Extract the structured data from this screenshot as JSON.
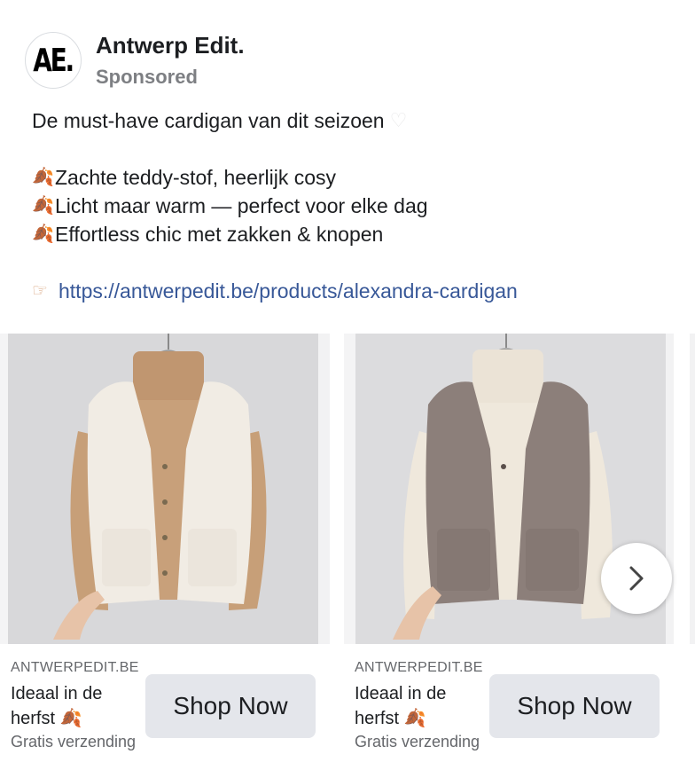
{
  "post": {
    "page_name": "Antwerp Edit.",
    "avatar_text": "AE.",
    "sponsored_label": "Sponsored",
    "headline": "De must-have cardigan van dit seizoen",
    "bullets": [
      "Zachte teddy-stof, heerlijk cosy",
      "Licht maar warm — perfect voor elke dag",
      "Effortless chic met zakken & knopen"
    ],
    "link": "https://antwerpedit.be/products/alexandra-cardigan"
  },
  "icons": {
    "heart": "white-heart-emoji",
    "leaf": "fallen-leaf-emoji",
    "pointing": "pointing-right-emoji"
  },
  "carousel": {
    "cards": [
      {
        "domain": "ANTWERPEDIT.BE",
        "title": "Ideaal in de herfst",
        "subtitle": "Gratis verzending",
        "button_label": "Shop Now"
      },
      {
        "domain": "ANTWERPEDIT.BE",
        "title": "Ideaal in de herfst",
        "subtitle": "Gratis verzending",
        "button_label": "Shop Now"
      }
    ]
  },
  "colors": {
    "link": "#385898",
    "button_bg": "#e4e6eb",
    "secondary_text": "#65676b"
  }
}
